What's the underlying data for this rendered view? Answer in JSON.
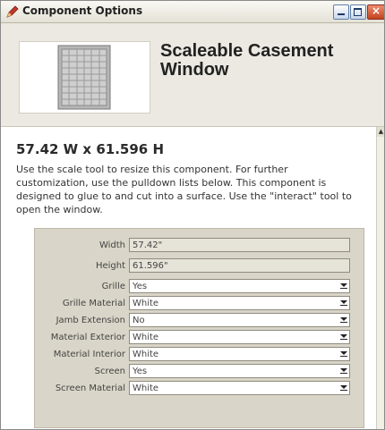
{
  "window": {
    "title": "Component Options",
    "controls": {
      "minimize": "minimize",
      "maximize": "maximize",
      "close": "×"
    }
  },
  "component": {
    "name": "Scaleable Casement Window",
    "thumbnail_icon": "window-thumbnail-icon",
    "dimensions": "57.42 W x 61.596 H",
    "description": "Use the scale tool to resize this component. For further customization, use the pulldown lists below. This component is designed to glue to and cut into a surface. Use the \"interact\" tool to open the window."
  },
  "options": [
    {
      "label": "Width",
      "value": "57.42\"",
      "type": "text"
    },
    {
      "label": "Height",
      "value": "61.596\"",
      "type": "text"
    },
    {
      "label": "Grille",
      "value": "Yes",
      "type": "select"
    },
    {
      "label": "Grille Material",
      "value": "White",
      "type": "select"
    },
    {
      "label": "Jamb Extension",
      "value": "No",
      "type": "select"
    },
    {
      "label": "Material Exterior",
      "value": "White",
      "type": "select"
    },
    {
      "label": "Material Interior",
      "value": "White",
      "type": "select"
    },
    {
      "label": "Screen",
      "value": "Yes",
      "type": "select"
    },
    {
      "label": "Screen Material",
      "value": "White",
      "type": "select"
    }
  ],
  "colors": {
    "titlebar": "#e4e2d6",
    "header_bg": "#ebe9e1",
    "options_panel_bg": "#d9d5c8",
    "close_button": "#c4441f",
    "app_icon": "#c0392b"
  },
  "icons": [
    "pencil-app-icon",
    "minimize-icon",
    "maximize-icon",
    "close-icon",
    "window-thumbnail-icon",
    "scroll-up-arrow-icon",
    "dropdown-arrow-icon"
  ]
}
